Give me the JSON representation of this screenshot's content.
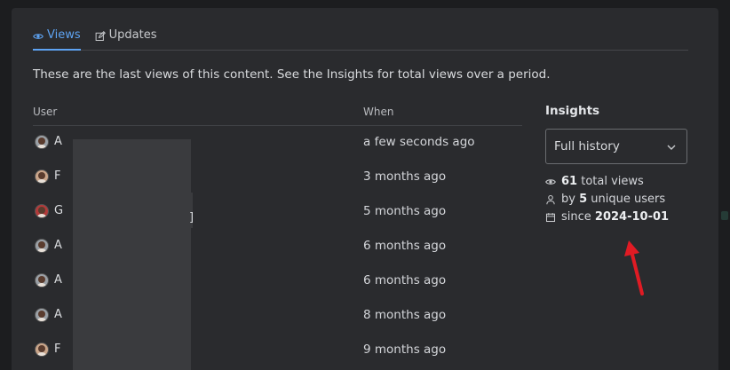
{
  "tabs": [
    {
      "label": "Views",
      "icon": "eye-icon",
      "active": true
    },
    {
      "label": "Updates",
      "icon": "edit-icon",
      "active": false
    }
  ],
  "intro": "These are the last views of this content. See the Insights for total views over a period.",
  "table": {
    "headers": {
      "user": "User",
      "when": "When"
    },
    "rows": [
      {
        "user": "A",
        "when": "a few seconds ago"
      },
      {
        "user": "F",
        "when": "3 months ago"
      },
      {
        "user": "G",
        "when": "5 months ago"
      },
      {
        "user": "A",
        "when": "6 months ago"
      },
      {
        "user": "A",
        "when": "6 months ago"
      },
      {
        "user": "A",
        "when": "8 months ago"
      },
      {
        "user": "F",
        "when": "9 months ago"
      }
    ],
    "redacted_suffix": "]"
  },
  "insights": {
    "title": "Insights",
    "period": "Full history",
    "total_views": {
      "value": "61",
      "label": "total views"
    },
    "unique_users": {
      "prefix": "by",
      "value": "5",
      "label": "unique users"
    },
    "since": {
      "prefix": "since",
      "value": "2024-10-01"
    }
  },
  "colors": {
    "accent": "#5ea3f2",
    "annotation_arrow": "#e01b24"
  }
}
